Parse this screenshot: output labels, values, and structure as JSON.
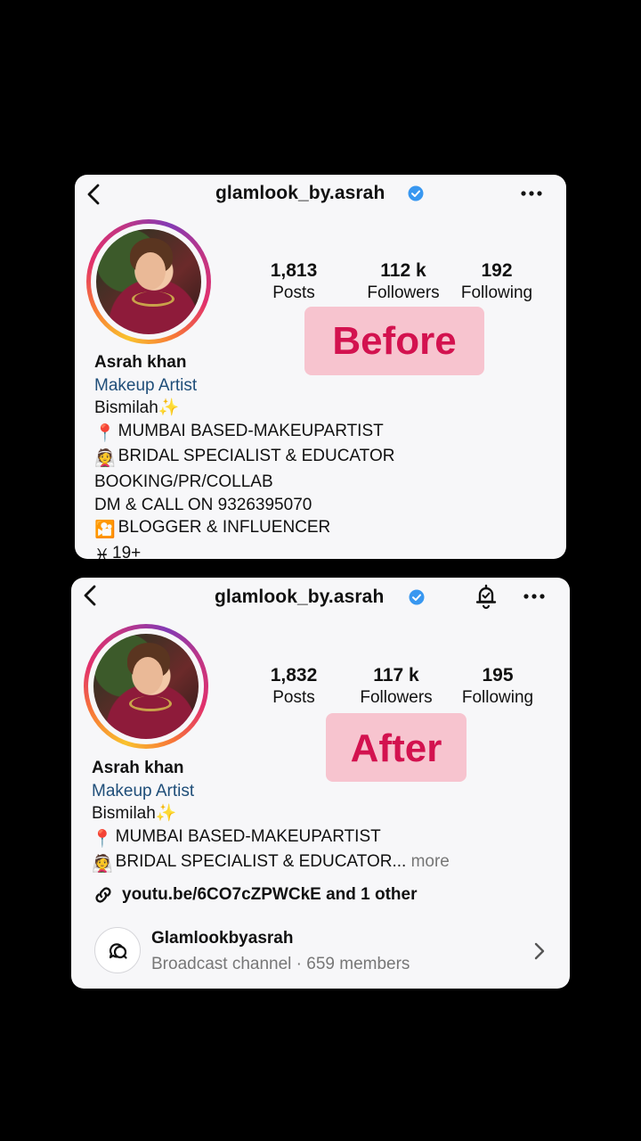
{
  "before": {
    "username": "glamlook_by.asrah",
    "stats": [
      {
        "value": "1,813",
        "label": "Posts"
      },
      {
        "value": "112 k",
        "label": "Followers"
      },
      {
        "value": "192",
        "label": "Following"
      }
    ],
    "badge": "Before",
    "name": "Asrah khan",
    "category": "Makeup Artist",
    "bio": [
      {
        "emoji": "",
        "text": "Bismilah",
        "trail": "✨"
      },
      {
        "emoji": "📍",
        "text": "MUMBAI BASED-MAKEUPARTIST"
      },
      {
        "emoji": "👰",
        "text": "BRIDAL SPECIALIST & EDUCATOR"
      },
      {
        "emoji": "",
        "text": "BOOKING/PR/COLLAB"
      },
      {
        "emoji": "",
        "text": "DM & CALL ON 9326395070"
      },
      {
        "emoji": "🎦",
        "text": "BLOGGER & INFLUENCER"
      },
      {
        "emoji": "♓",
        "text": "19+"
      }
    ]
  },
  "after": {
    "username": "glamlook_by.asrah",
    "stats": [
      {
        "value": "1,832",
        "label": "Posts"
      },
      {
        "value": "117 k",
        "label": "Followers"
      },
      {
        "value": "195",
        "label": "Following"
      }
    ],
    "badge": "After",
    "name": "Asrah khan",
    "category": "Makeup Artist",
    "bio": [
      {
        "emoji": "",
        "text": "Bismilah",
        "trail": "✨"
      },
      {
        "emoji": "📍",
        "text": "MUMBAI BASED-MAKEUPARTIST"
      },
      {
        "emoji": "👰",
        "text": "BRIDAL SPECIALIST & EDUCATOR...",
        "more": "more"
      }
    ],
    "link": "youtu.be/6CO7cZPWCkE and 1 other",
    "channel": {
      "name": "Glamlookbyasrah",
      "meta": "Broadcast channel · 659 members"
    }
  },
  "colors": {
    "verified": "#3897f0",
    "badge_bg": "#f7c4cf",
    "badge_text": "#d3124f",
    "category": "#1f4e79"
  },
  "icons": [
    "back-icon",
    "verified-icon",
    "more-icon",
    "bell-icon",
    "link-icon",
    "broadcast-channel-icon",
    "chevron-right-icon"
  ]
}
